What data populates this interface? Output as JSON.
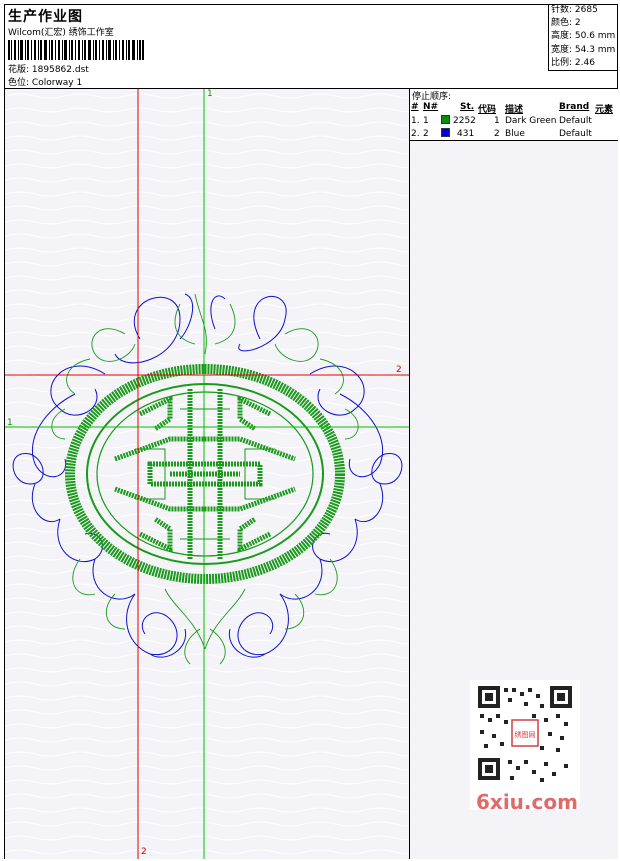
{
  "header": {
    "title": "生产作业图",
    "company": "Wilcom(汇宏) 绣饰工作室",
    "design_label": "花版:",
    "design_file": "1895862.dst",
    "colorway_label": "色位:",
    "colorway_name": "Colorway 1"
  },
  "stats": {
    "stitches": "针数: 2685",
    "colors": "颜色: 2",
    "height": "高度: 50.6 mm",
    "width": "宽度: 54.3 mm",
    "ratio": "比例: 2.46"
  },
  "stop_sequence": {
    "title": "停止顺序:",
    "headers": [
      "#",
      "N#",
      "St.",
      "代码",
      "描述",
      "Brand",
      "元素"
    ],
    "rows": [
      {
        "idx": "1.",
        "n": "1",
        "stitches": "2252",
        "code": "1",
        "desc": "Dark Green",
        "brand": "Default",
        "color": "#0a8a0a"
      },
      {
        "idx": "2.",
        "n": "2",
        "stitches": "431",
        "code": "2",
        "desc": "Blue",
        "brand": "Default",
        "color": "#0000dd"
      }
    ]
  },
  "axes": {
    "green_top": "1",
    "green_left": "1",
    "red_right": "2",
    "red_bottom": "2"
  },
  "watermark": "6xiu.com",
  "qr_badge": "绣图网",
  "colors": {
    "thread_green": "#1a9a1a",
    "thread_blue": "#1010d0",
    "axis_red": "#e00000",
    "axis_green": "#00c000"
  }
}
